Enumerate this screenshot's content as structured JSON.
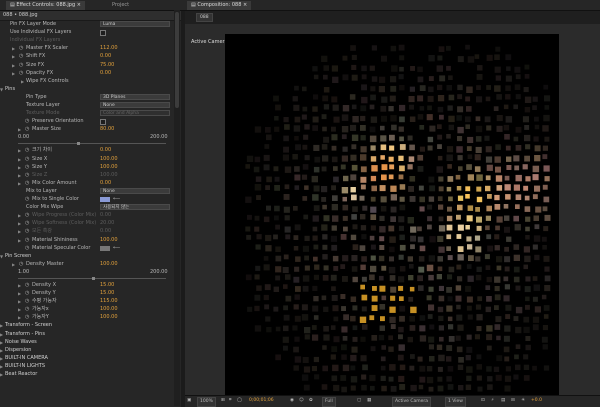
{
  "tabs": {
    "effect_controls": "Effect Controls: 088.jpg",
    "project": "Project",
    "composition": "Composition: 088"
  },
  "left_panel": {
    "header": "088 • 088.jpg"
  },
  "rows": [
    {
      "t": "dd",
      "x": 10,
      "label": "Pin FX Layer Mode",
      "value": "Luma"
    },
    {
      "t": "chk",
      "x": 10,
      "label": "Use Individual FX Layers"
    },
    {
      "t": "text",
      "x": 10,
      "label": "Individual FX Layers",
      "dim": true
    },
    {
      "t": "val",
      "x": 26,
      "label": "Master FX Scaler",
      "value": "112.00",
      "tri": true,
      "sw": true
    },
    {
      "t": "val",
      "x": 26,
      "label": "Shift FX",
      "value": "0.00",
      "tri": true,
      "sw": true
    },
    {
      "t": "val",
      "x": 26,
      "label": "Size FX",
      "value": "75.00",
      "tri": true,
      "sw": true
    },
    {
      "t": "val",
      "x": 26,
      "label": "Opacity FX",
      "value": "0.00",
      "tri": true,
      "sw": true
    },
    {
      "t": "text",
      "x": 26,
      "label": "Wipe FX Controls",
      "tri": true
    },
    {
      "t": "sect",
      "x": 5,
      "label": "Pins",
      "tri": true
    },
    {
      "t": "dd",
      "x": 26,
      "label": "Pin Type",
      "value": "3D Planes"
    },
    {
      "t": "dd",
      "x": 26,
      "label": "Texture Layer",
      "value": "None"
    },
    {
      "t": "dd",
      "x": 26,
      "label": "Texture Mode",
      "value": "Color and Alpha",
      "dim": true
    },
    {
      "t": "chk",
      "x": 32,
      "label": "Preserve Orientation",
      "sw": true
    },
    {
      "t": "val",
      "x": 32,
      "label": "Master Size",
      "value": "80.00",
      "tri": true,
      "sw": true
    },
    {
      "t": "range",
      "min": "0.00",
      "max": "200.00",
      "knob": 0.4
    },
    {
      "t": "val",
      "x": 32,
      "label": "크기 차이",
      "value": "0.00",
      "tri": true,
      "sw": true
    },
    {
      "t": "val",
      "x": 32,
      "label": "Size X",
      "value": "100.00",
      "tri": true,
      "sw": true
    },
    {
      "t": "val",
      "x": 32,
      "label": "Size Y",
      "value": "100.00",
      "tri": true,
      "sw": true
    },
    {
      "t": "val",
      "x": 32,
      "label": "Size Z",
      "value": "100.00",
      "tri": true,
      "sw": true,
      "dim": true
    },
    {
      "t": "val",
      "x": 32,
      "label": "Mix Color Amount",
      "value": "0.00",
      "tri": true,
      "sw": true
    },
    {
      "t": "dd",
      "x": 26,
      "label": "Mix to Layer",
      "value": "None"
    },
    {
      "t": "color",
      "x": 32,
      "label": "Mix to Single Color",
      "color": "#8a9ad6",
      "sw": true
    },
    {
      "t": "dd",
      "x": 26,
      "label": "Color Mix Wipe",
      "value": "사용되지 않는"
    },
    {
      "t": "val",
      "x": 32,
      "label": "Wipe Progress (Color Mix)",
      "value": "0.00",
      "tri": true,
      "sw": true,
      "dim": true
    },
    {
      "t": "val",
      "x": 32,
      "label": "Wipe Softness (Color Mix)",
      "value": "20.00",
      "tri": true,
      "sw": true,
      "dim": true
    },
    {
      "t": "val",
      "x": 32,
      "label": "모든 흑광",
      "value": "0.00",
      "tri": true,
      "sw": true,
      "dim": true
    },
    {
      "t": "val",
      "x": 32,
      "label": "Material Shininess",
      "value": "100.00",
      "tri": true,
      "sw": true
    },
    {
      "t": "color",
      "x": 32,
      "label": "Material Specular Color",
      "color": "#777777",
      "sw": true
    },
    {
      "t": "sect",
      "x": 5,
      "label": "Pin Screen",
      "tri": true
    },
    {
      "t": "val",
      "x": 26,
      "label": "Density Master",
      "value": "100.00",
      "tri": true,
      "sw": true
    },
    {
      "t": "range",
      "min": "1.00",
      "max": "200.00",
      "knob": 0.5
    },
    {
      "t": "val",
      "x": 32,
      "label": "Density X",
      "value": "15.00",
      "tri": true,
      "sw": true
    },
    {
      "t": "val",
      "x": 32,
      "label": "Density Y",
      "value": "15.00",
      "tri": true,
      "sw": true
    },
    {
      "t": "val",
      "x": 32,
      "label": "수평 가능자",
      "value": "115.00",
      "tri": true,
      "sw": true
    },
    {
      "t": "val",
      "x": 32,
      "label": "가능자x",
      "value": "100.00",
      "tri": true,
      "sw": true
    },
    {
      "t": "val",
      "x": 32,
      "label": "가능자Y",
      "value": "100.00",
      "tri": true,
      "sw": true
    },
    {
      "t": "sect",
      "x": 5,
      "label": "Transform - Screen",
      "tri": true,
      "plain": true
    },
    {
      "t": "sect",
      "x": 5,
      "label": "Transform - Pins",
      "tri": true,
      "plain": true
    },
    {
      "t": "sect",
      "x": 5,
      "label": "Noise Waves",
      "tri": true,
      "plain": true
    },
    {
      "t": "sect",
      "x": 5,
      "label": "Dispersion",
      "tri": true,
      "plain": true
    },
    {
      "t": "sect",
      "x": 5,
      "label": "BUILT-IN CAMERA",
      "tri": true,
      "dim": true
    },
    {
      "t": "sect",
      "x": 5,
      "label": "BUILT-IN LIGHTS",
      "tri": true,
      "plain": true
    },
    {
      "t": "sect",
      "x": 5,
      "label": "Beat Reactor",
      "tri": true,
      "plain": true
    }
  ],
  "composition": {
    "tab": "088",
    "viewer_label": "Active Camera"
  },
  "bottom_bar": {
    "zoom": "100%",
    "timecode": "0;00;01;06",
    "resolution": "Full",
    "camera": "Active Camera",
    "view": "1 View",
    "exposure": "+0.0"
  },
  "colors": {
    "accent": "#e2a13c",
    "swatch": "#8a9ad6"
  },
  "icons": [
    "panel-menu-icon",
    "lock-icon",
    "close-icon",
    "stopwatch-icon",
    "disclosure-triangle-icon",
    "snapshot-icon",
    "grid-icon",
    "channel-icon"
  ]
}
